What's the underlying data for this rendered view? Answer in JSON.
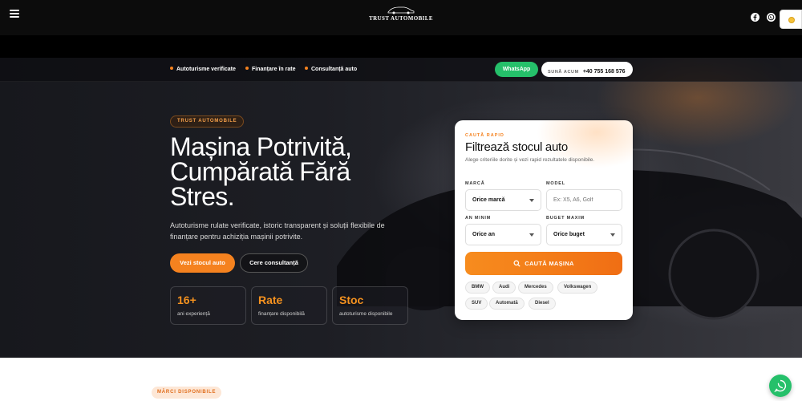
{
  "header": {
    "logo_text": "TRUST AUTOMOBILE",
    "menu_icon": "hamburger-menu-icon",
    "social_icons": [
      "facebook-icon",
      "whatsapp-icon"
    ]
  },
  "infobar": {
    "features": [
      "Autoturisme verificate",
      "Finanțare în rate",
      "Consultanță auto"
    ],
    "whatsapp_label": "WhatsApp",
    "call_label": "SUNĂ ACUM",
    "call_number": "+40 755 168 576"
  },
  "hero": {
    "badge": "TRUST AUTOMOBILE",
    "headline": "Mașina Potrivită, Cumpărată Fără Stres.",
    "subtext": "Autoturisme rulate verificate, istoric transparent și soluții flexibile de finanțare pentru achiziția mașinii potrivite.",
    "primary_cta": "Vezi stocul auto",
    "secondary_cta": "Cere consultanță",
    "stats": [
      {
        "value": "16+",
        "label": "ani experiență"
      },
      {
        "value": "Rate",
        "label": "finanțare disponibilă"
      },
      {
        "value": "Stoc",
        "label": "autoturisme disponibile"
      }
    ]
  },
  "filter": {
    "eyebrow": "CAUTĂ RAPID",
    "title": "Filtrează stocul auto",
    "description": "Alege criteriile dorite și vezi rapid rezultatele disponibile.",
    "brand_label": "MARCĂ",
    "brand_value": "Orice marcă",
    "model_label": "MODEL",
    "model_placeholder": "Ex: X5, A6, Golf",
    "year_label": "AN MINIM",
    "year_value": "Orice an",
    "budget_label": "BUGET MAXIM",
    "budget_value": "Orice buget",
    "search_label": "CAUTĂ MAȘINA",
    "chips": [
      "BMW",
      "Audi",
      "Mercedes",
      "Volkswagen",
      "SUV",
      "Automată",
      "Diesel"
    ]
  },
  "next_section": {
    "badge": "MĂRCI DISPONIBILE"
  },
  "colors": {
    "accent": "#f5821f",
    "whatsapp": "#25c06a",
    "dark": "#0c0c0c"
  }
}
